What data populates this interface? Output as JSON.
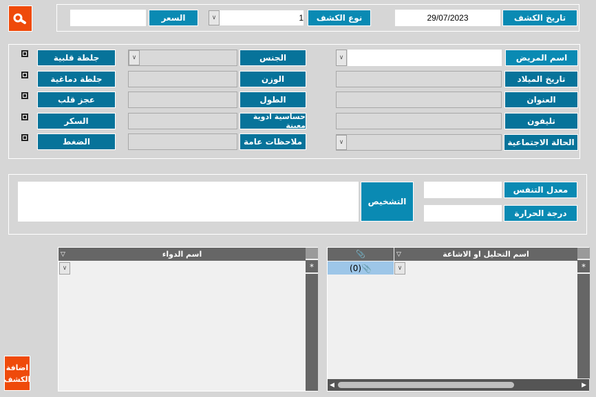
{
  "toolbar": {
    "search_icon": "search-icon",
    "search_color": "#ef4a0a"
  },
  "header": {
    "visit_date_label": "تاريخ الكشف",
    "visit_date_value": "29/07/2023",
    "visit_type_label": "نوع الكشف",
    "visit_type_value": "1",
    "price_label": "السعر",
    "price_value": ""
  },
  "patient": {
    "name_label": "اسم المريض",
    "birth_label": "تاريخ الميلاد",
    "address_label": "العنوان",
    "phone_label": "تليفون",
    "marital_label": "الحالة الاجتماعية",
    "gender_label": "الجنس",
    "weight_label": "الوزن",
    "height_label": "الطول",
    "allergy_label": "حساسية ادوية معينة",
    "notes_label": "ملاحظات عامة",
    "conditions": [
      {
        "label": "جلطة قلبية",
        "checked": false
      },
      {
        "label": "جلطة دماغية",
        "checked": false
      },
      {
        "label": "عجز قلب",
        "checked": false
      },
      {
        "label": "السكر",
        "checked": false
      },
      {
        "label": "الضغط",
        "checked": false
      }
    ]
  },
  "vitals": {
    "resp_label": "معدل التنفس",
    "temp_label": "درجة الحرارة",
    "diagnosis_label": "التشخيص"
  },
  "tests_grid": {
    "attach_header": "📎",
    "name_header": "اسم التحليل او الاشاعة",
    "new_row_attach": "(0)",
    "new_row_marker": "*"
  },
  "drugs_grid": {
    "name_header": "اسم الدواء",
    "new_row_marker": "*"
  },
  "add_button": {
    "label_line1": "اضافة",
    "label_line2": "الكشف"
  },
  "colors": {
    "accent_light": "#0a8ab3",
    "accent_dark": "#07739a",
    "orange": "#ef4a0a",
    "grid_header": "#666666"
  }
}
